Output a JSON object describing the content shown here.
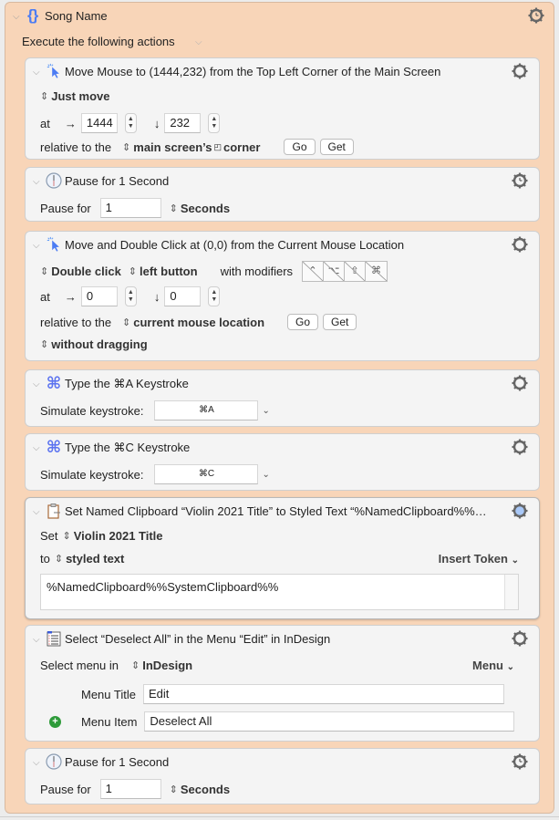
{
  "group": {
    "title": "Song Name",
    "icon": "braces-icon",
    "execute_label": "Execute the following actions"
  },
  "actions": [
    {
      "type": "move-mouse",
      "title": "Move Mouse to (1444,232) from the Top Left Corner of the Main Screen",
      "mode": "Just move",
      "at_label": "at",
      "x": "1444",
      "y": "232",
      "relative_label": "relative to the",
      "relative_value": "main screen’s",
      "corner_label": "corner",
      "go_label": "Go",
      "get_label": "Get"
    },
    {
      "type": "pause",
      "title": "Pause for 1 Second",
      "pause_label": "Pause for",
      "value": "1",
      "unit": "Seconds"
    },
    {
      "type": "move-click",
      "title": "Move and Double Click at (0,0) from the Current Mouse Location",
      "click_type": "Double click",
      "button": "left button",
      "modifiers_label": "with modifiers",
      "modifiers": [
        "⌃",
        "⌥",
        "⇧",
        "⌘"
      ],
      "at_label": "at",
      "x": "0",
      "y": "0",
      "relative_label": "relative to the",
      "relative_value": "current mouse location",
      "go_label": "Go",
      "get_label": "Get",
      "drag": "without dragging"
    },
    {
      "type": "keystroke",
      "title": "Type the ⌘A Keystroke",
      "label": "Simulate keystroke:",
      "value": "⌘A"
    },
    {
      "type": "keystroke",
      "title": "Type the ⌘C Keystroke",
      "label": "Simulate keystroke:",
      "value": "⌘C"
    },
    {
      "type": "set-clipboard",
      "title": "Set Named Clipboard “Violin 2021 Title” to Styled Text “%NamedClipboard%%…",
      "set_label": "Set",
      "clipboard_name": "Violin 2021 Title",
      "to_label": "to",
      "to_value": "styled text",
      "insert_token": "Insert Token",
      "text": "%NamedClipboard%%SystemClipboard%%"
    },
    {
      "type": "select-menu",
      "title": "Select “Deselect All” in the Menu “Edit” in InDesign",
      "select_label": "Select menu in",
      "app": "InDesign",
      "menu_btn": "Menu",
      "menu_title_label": "Menu Title",
      "menu_title": "Edit",
      "menu_item_label": "Menu Item",
      "menu_item": "Deselect All"
    },
    {
      "type": "pause",
      "title": "Pause for 1 Second",
      "pause_label": "Pause for",
      "value": "1",
      "unit": "Seconds"
    }
  ],
  "colors": {
    "group_bg": "#f8d5b8",
    "action_bg": "#f4f4f4",
    "icon_blue": "#4c7cf3",
    "add_green": "#2e9b3a"
  }
}
